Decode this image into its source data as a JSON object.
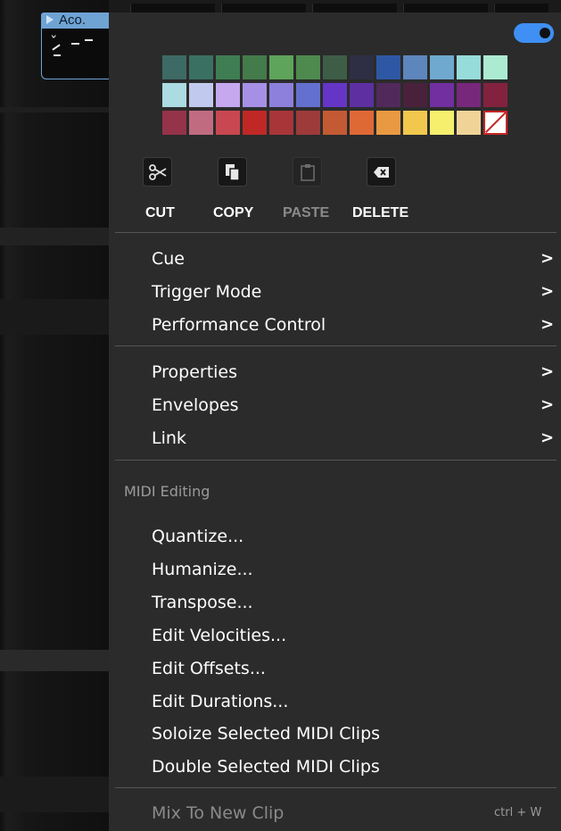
{
  "clip": {
    "name": "Aco.",
    "header_color": "#6ea3d4",
    "icons": [
      "play-icon",
      "wrench-icon"
    ]
  },
  "menu": {
    "toggle": {
      "state": "on",
      "color": "#3f8ff4"
    },
    "swatch_rows": [
      [
        "#3d6a65",
        "#3a7062",
        "#3f7d52",
        "#447b4a",
        "#5ea45a",
        "#4e8a4e",
        "#3e5d47",
        "#2e2f45",
        "#2e58a4",
        "#5d86bd",
        "#6fa9cf",
        "#96dcdb",
        "#acebd2"
      ],
      [
        "#acdbe2",
        "#c2c9ee",
        "#c5a8ee",
        "#a690e6",
        "#8c80dc",
        "#6470cf",
        "#6535c6",
        "#5d2fa1",
        "#52295b",
        "#4a213a",
        "#712fa0",
        "#77287a",
        "#83223e"
      ],
      [
        "#94334a",
        "#c16b81",
        "#c94750",
        "#c02826",
        "#a83538",
        "#9d3a3a",
        "#c35a34",
        "#df6935",
        "#e99942",
        "#f1c74e",
        "#f6ef6e",
        "#f0d497",
        "none"
      ]
    ],
    "edit_buttons": [
      {
        "label": "CUT",
        "icon": "scissors-icon",
        "enabled": true
      },
      {
        "label": "COPY",
        "icon": "copy-icon",
        "enabled": true
      },
      {
        "label": "PASTE",
        "icon": "clipboard-icon",
        "enabled": false
      },
      {
        "label": "DELETE",
        "icon": "backspace-icon",
        "enabled": true
      }
    ],
    "group1": [
      {
        "label": "Cue",
        "submenu": true
      },
      {
        "label": "Trigger Mode",
        "submenu": true
      },
      {
        "label": "Performance Control",
        "submenu": true
      }
    ],
    "group2": [
      {
        "label": "Properties",
        "submenu": true
      },
      {
        "label": "Envelopes",
        "submenu": true
      },
      {
        "label": "Link",
        "submenu": true
      }
    ],
    "midi_header": "MIDI Editing",
    "midi_items": [
      "Quantize...",
      "Humanize...",
      "Transpose...",
      "Edit Velocities...",
      "Edit Offsets...",
      "Edit Durations...",
      "Soloize Selected MIDI Clips",
      "Double Selected MIDI Clips"
    ],
    "mix_item": {
      "label": "Mix To New Clip",
      "shortcut": "ctrl + W",
      "enabled": false
    },
    "colors": {
      "menu_bg": "#2b2b2b",
      "text": "#ffffff",
      "disabled_text": "#8a8a8a",
      "separator": "#555555"
    }
  }
}
